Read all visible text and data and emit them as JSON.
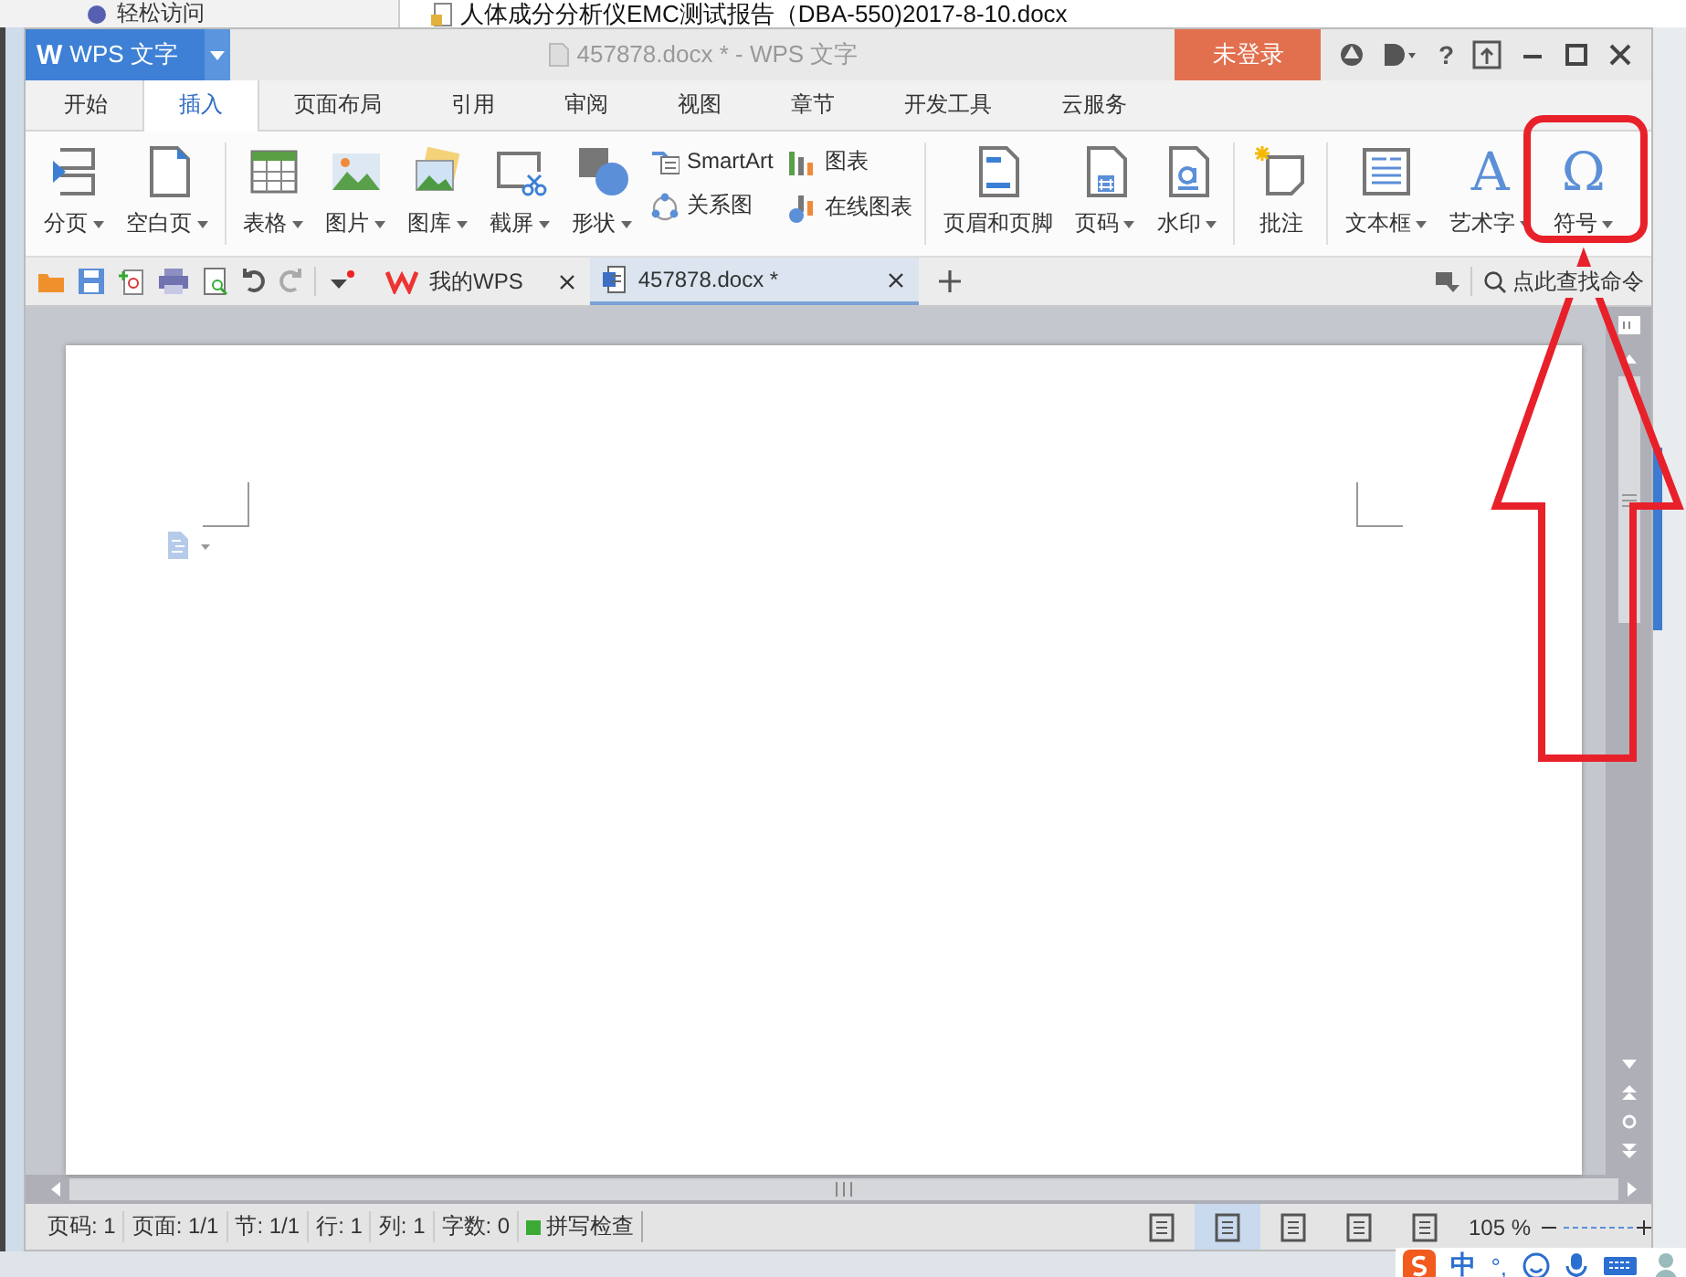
{
  "background": {
    "sidebar_item": "轻松访问",
    "file_name": "人体成分分析仪EMC测试报告（DBA-550)2017-8-10.docx"
  },
  "title_bar": {
    "logo_glyph": "W",
    "app_menu": "WPS 文字",
    "document_title": "457878.docx * - WPS 文字",
    "login_button": "未登录",
    "help_label": "?"
  },
  "tabs": [
    {
      "label": "开始",
      "selected": false
    },
    {
      "label": "插入",
      "selected": true
    },
    {
      "label": "页面布局",
      "selected": false
    },
    {
      "label": "引用",
      "selected": false
    },
    {
      "label": "审阅",
      "selected": false
    },
    {
      "label": "视图",
      "selected": false
    },
    {
      "label": "章节",
      "selected": false
    },
    {
      "label": "开发工具",
      "selected": false
    },
    {
      "label": "云服务",
      "selected": false
    }
  ],
  "ribbon": {
    "groups": [
      {
        "items": [
          {
            "kind": "large",
            "label": "分页",
            "dropdown": true
          },
          {
            "kind": "large",
            "label": "空白页",
            "dropdown": true
          }
        ]
      },
      {
        "items": [
          {
            "kind": "large",
            "label": "表格",
            "dropdown": true
          },
          {
            "kind": "large",
            "label": "图片",
            "dropdown": true
          },
          {
            "kind": "large",
            "label": "图库",
            "dropdown": true
          },
          {
            "kind": "large",
            "label": "截屏",
            "dropdown": true
          },
          {
            "kind": "large",
            "label": "形状",
            "dropdown": true
          },
          {
            "kind": "stack",
            "items": [
              {
                "label": "SmartArt"
              },
              {
                "label": "关系图"
              }
            ]
          },
          {
            "kind": "stack",
            "items": [
              {
                "label": "图表"
              },
              {
                "label": "在线图表"
              }
            ]
          }
        ]
      },
      {
        "items": [
          {
            "kind": "large",
            "label": "页眉和页脚",
            "dropdown": false
          },
          {
            "kind": "large",
            "label": "页码",
            "dropdown": true
          },
          {
            "kind": "large",
            "label": "水印",
            "dropdown": true
          }
        ]
      },
      {
        "items": [
          {
            "kind": "large",
            "label": "批注",
            "dropdown": false
          }
        ]
      },
      {
        "items": [
          {
            "kind": "large",
            "label": "文本框",
            "dropdown": true
          },
          {
            "kind": "glyph",
            "glyph": "A",
            "label": "艺术字",
            "dropdown": true
          },
          {
            "kind": "glyph",
            "glyph": "Ω",
            "label": "符号",
            "dropdown": true
          }
        ]
      }
    ]
  },
  "quick_bar": {
    "doc_tabs": [
      {
        "label": "我的WPS",
        "selected": false
      },
      {
        "label": "457878.docx *",
        "selected": true
      }
    ],
    "command_search": "点此查找命令"
  },
  "status_bar": {
    "items": [
      "页码: 1",
      "页面: 1/1",
      "节: 1/1",
      "行: 1",
      "列: 1",
      "字数: 0"
    ],
    "spell_check": "拼写检查",
    "view_buttons": [
      {
        "selected": false
      },
      {
        "selected": true
      },
      {
        "selected": false
      },
      {
        "selected": false
      },
      {
        "selected": false
      }
    ],
    "zoom": "105 %"
  },
  "taskbar": {
    "ime_label": "中",
    "punctuation": "°,"
  }
}
